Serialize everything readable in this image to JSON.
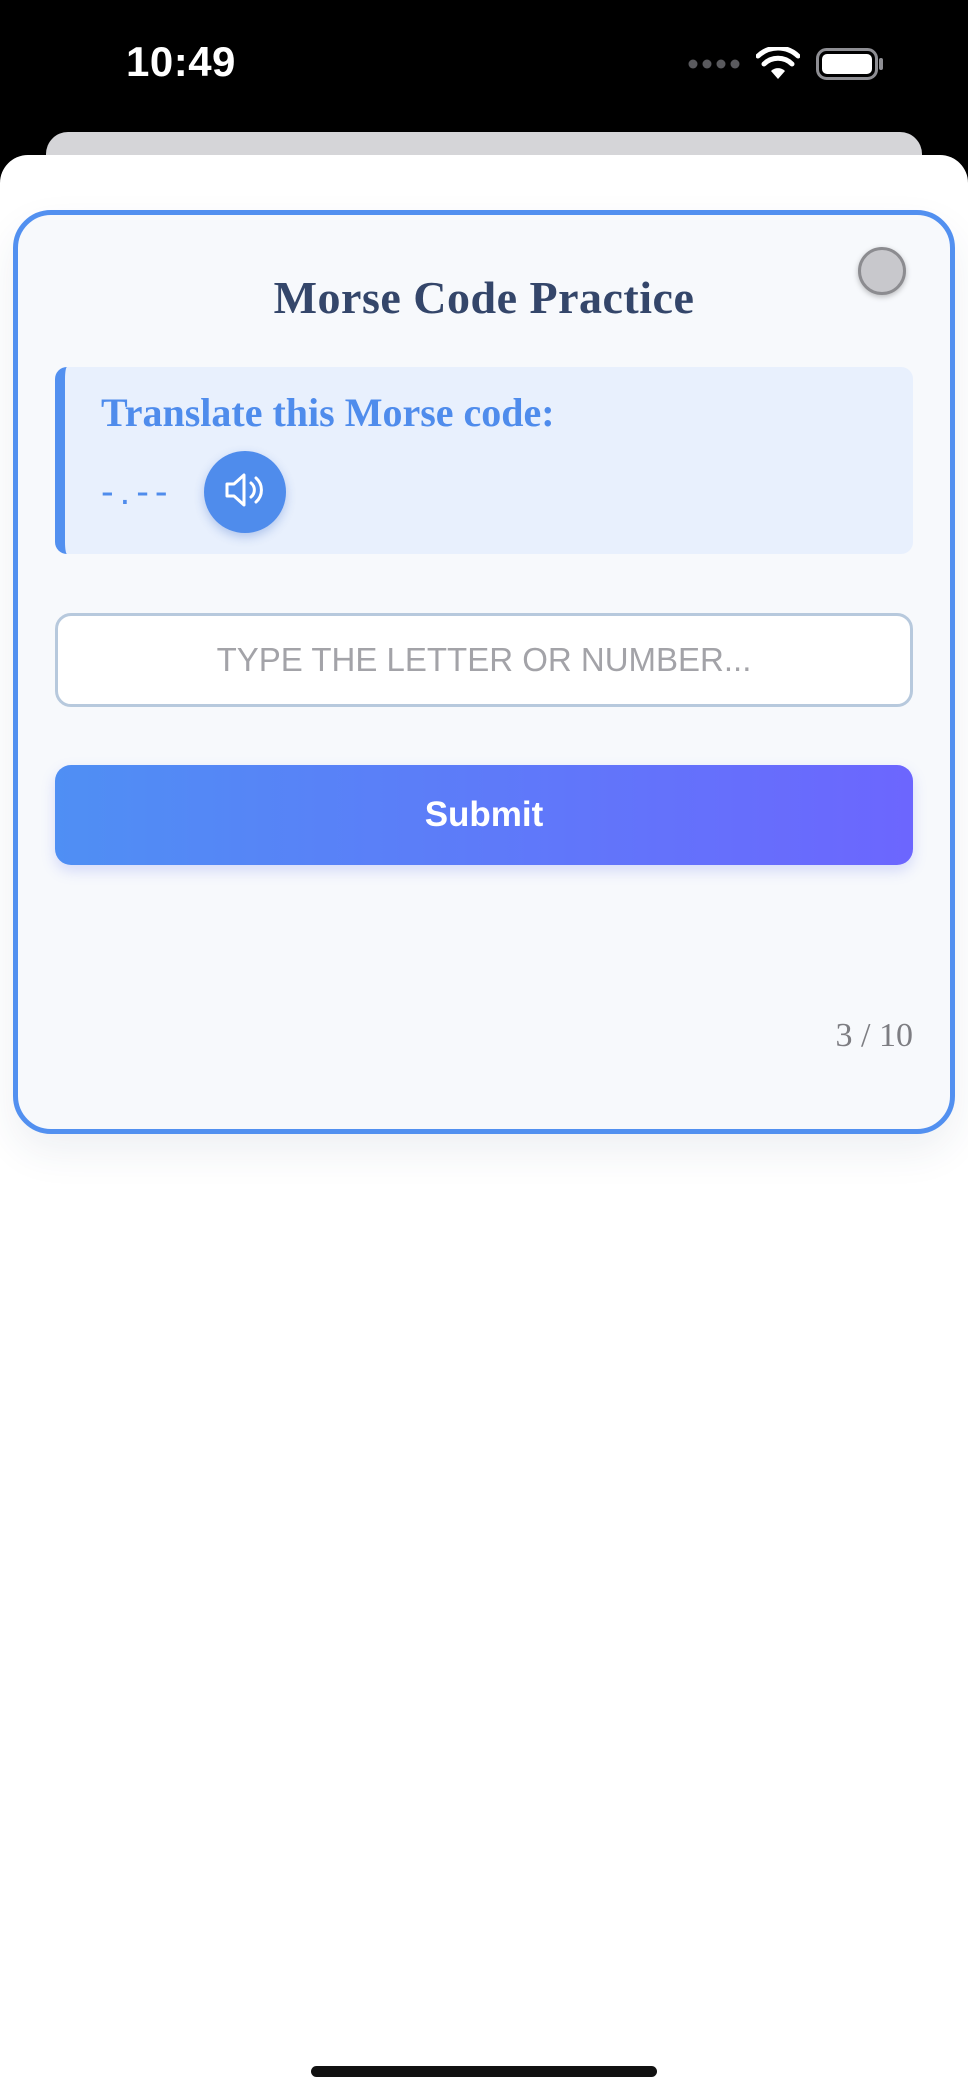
{
  "status_bar": {
    "time": "10:49",
    "icons": [
      "signal-dots-icon",
      "wifi-icon",
      "battery-icon"
    ]
  },
  "card": {
    "title": "Morse Code Practice",
    "toggle_icon": "circle-toggle-icon",
    "prompt": {
      "label": "Translate this Morse code:",
      "code": "-.--",
      "play_icon": "speaker-icon"
    },
    "answer": {
      "value": "",
      "placeholder": "TYPE THE LETTER OR NUMBER..."
    },
    "submit_label": "Submit",
    "progress": "3 / 10"
  },
  "colors": {
    "accent": "#5290f0",
    "title": "#34466a",
    "gradient_start": "#4f8ff4",
    "gradient_end": "#6c66fe"
  }
}
